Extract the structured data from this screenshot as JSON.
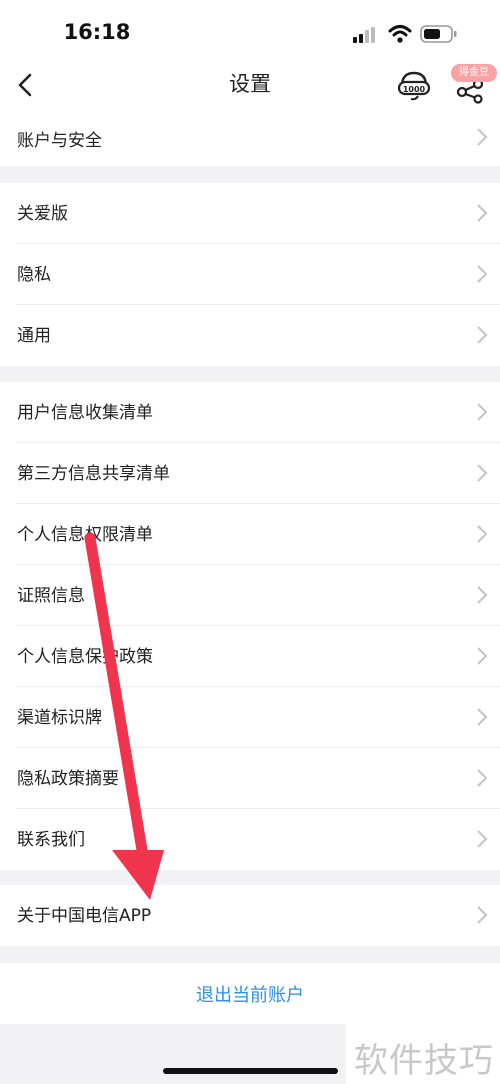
{
  "status_bar": {
    "time": "16:18"
  },
  "nav": {
    "title": "设置",
    "coin_badge": "得金豆"
  },
  "groups": [
    {
      "items": [
        {
          "label": "账户与安全"
        }
      ]
    },
    {
      "items": [
        {
          "label": "关爱版"
        },
        {
          "label": "隐私"
        },
        {
          "label": "通用"
        }
      ]
    },
    {
      "items": [
        {
          "label": "用户信息收集清单"
        },
        {
          "label": "第三方信息共享清单"
        },
        {
          "label": "个人信息权限清单"
        },
        {
          "label": "证照信息"
        },
        {
          "label": "个人信息保护政策"
        },
        {
          "label": "渠道标识牌"
        },
        {
          "label": "隐私政策摘要"
        },
        {
          "label": "联系我们"
        }
      ]
    },
    {
      "items": [
        {
          "label": "关于中国电信APP"
        }
      ]
    }
  ],
  "logout_label": "退出当前账户",
  "watermark": "软件技巧",
  "colors": {
    "accent": "#2d8fe6",
    "arrow": "#f0344e",
    "background": "#f2f2f4"
  }
}
